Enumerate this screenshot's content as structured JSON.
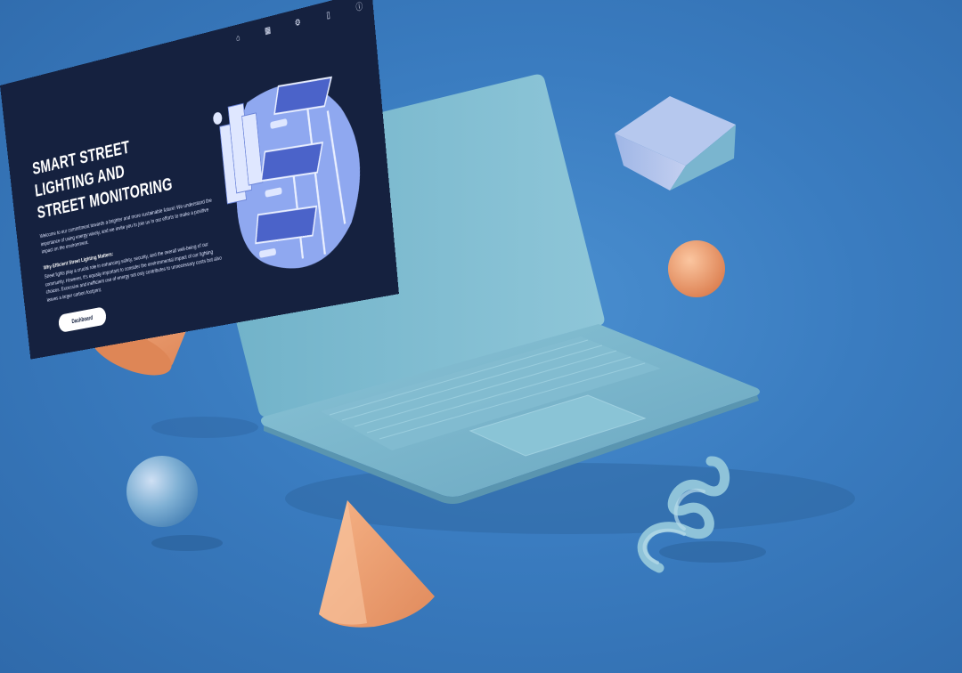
{
  "nav": {
    "icons": [
      "home-icon",
      "grid-icon",
      "network-icon",
      "document-icon",
      "info-icon"
    ]
  },
  "hero": {
    "title_lines": [
      "SMART STREET",
      "LIGHTING AND",
      "STREET MONITORING"
    ],
    "intro": "Welcome to our commitment towards a brighter and more sustainable future! We understand the importance of using energy wisely, and we invite you to join us in our efforts to make a positive impact on the environment.",
    "why_title": "Why Efficient Street Lighting Matters:",
    "why_text": "Street lights play a crucial role in enhancing safety, security, and the overall well-being of our community. However, it's equally important to consider the environmental impact of our lighting choices. Excessive and inefficient use of energy not only contributes to unnecessary costs but also leaves a larger carbon footprint.",
    "button_label": "Dashboard"
  },
  "colors": {
    "background": "#3a7cc0",
    "screen": "#15213f",
    "laptop_body": "#7fb9cf",
    "accent_orange": "#f0a070",
    "illustration_blob": "#8fa8f0"
  }
}
